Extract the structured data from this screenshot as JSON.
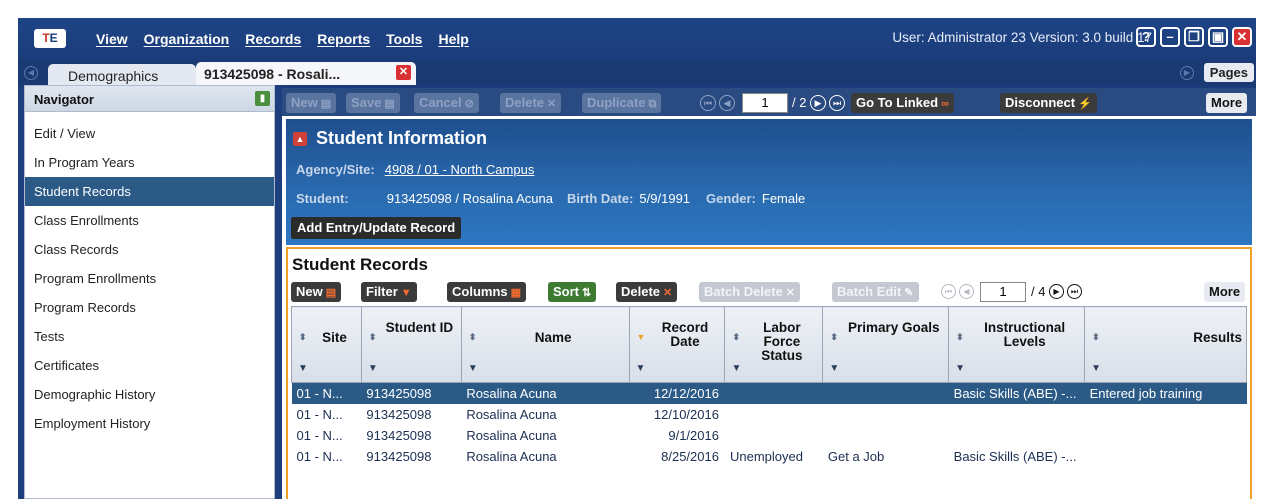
{
  "menubar": {
    "logo": {
      "t": "T",
      "e": "E"
    },
    "items": [
      "View",
      "Organization",
      "Records",
      "Reports",
      "Tools",
      "Help"
    ],
    "user_info": "User: Administrator 23   Version: 3.0 build 17",
    "window_buttons": {
      "help": "?",
      "minimize": "–",
      "restore": "❐",
      "maximize": "▣",
      "close": "✕"
    }
  },
  "tabs": {
    "tab1": "Demographics",
    "tab2": "913425098 - Rosali...",
    "close": "✕",
    "pages": "Pages"
  },
  "navigator": {
    "title": "Navigator",
    "pin_icon": "pin-icon",
    "items": [
      {
        "label": "Edit / View",
        "active": false
      },
      {
        "label": "In Program Years",
        "active": false
      },
      {
        "label": "Student Records",
        "active": true
      },
      {
        "label": "Class Enrollments",
        "active": false
      },
      {
        "label": "Class Records",
        "active": false
      },
      {
        "label": "Program Enrollments",
        "active": false
      },
      {
        "label": "Program Records",
        "active": false
      },
      {
        "label": "Tests",
        "active": false
      },
      {
        "label": "Certificates",
        "active": false
      },
      {
        "label": "Demographic History",
        "active": false
      },
      {
        "label": "Employment History",
        "active": false
      }
    ]
  },
  "toolbar": {
    "new": "New",
    "save": "Save",
    "cancel": "Cancel",
    "delete": "Delete",
    "duplicate": "Duplicate",
    "page": "1",
    "of_total": "/ 2",
    "go_to_linked": "Go To Linked",
    "disconnect": "Disconnect",
    "more": "More"
  },
  "student_info": {
    "title": "Student Information",
    "agency_label": "Agency/Site:",
    "agency_value": "4908 / 01 - North Campus",
    "student_label": "Student:",
    "student_value": "913425098 / Rosalina Acuna",
    "birth_label": "Birth Date:",
    "birth_value": "5/9/1991",
    "gender_label": "Gender:",
    "gender_value": "Female",
    "add_entry": "Add Entry/Update Record"
  },
  "records": {
    "title": "Student Records",
    "toolbar": {
      "new": "New",
      "filter": "Filter",
      "columns": "Columns",
      "sort": "Sort",
      "delete": "Delete",
      "batch_delete": "Batch Delete",
      "batch_edit": "Batch Edit",
      "page": "1",
      "of_total": "/ 4",
      "more": "More"
    },
    "columns": [
      {
        "label": "Site",
        "sort": "both"
      },
      {
        "label": "Student ID",
        "sort": "both"
      },
      {
        "label": "Name",
        "sort": "both"
      },
      {
        "label": "Record Date",
        "sort": "down"
      },
      {
        "label": "Labor Force Status",
        "sort": "both"
      },
      {
        "label": "Primary Goals",
        "sort": "both"
      },
      {
        "label": "Instructional Levels",
        "sort": "both"
      },
      {
        "label": "Results",
        "sort": "both"
      }
    ],
    "rows": [
      {
        "site": "01 - N...",
        "id": "913425098",
        "name": "Rosalina Acuna",
        "date": "12/12/2016",
        "labor": "",
        "goals": "",
        "levels": "Basic Skills (ABE) -...",
        "results": "Entered job training",
        "selected": true
      },
      {
        "site": "01 - N...",
        "id": "913425098",
        "name": "Rosalina Acuna",
        "date": "12/10/2016",
        "labor": "",
        "goals": "",
        "levels": "",
        "results": "",
        "selected": false
      },
      {
        "site": "01 - N...",
        "id": "913425098",
        "name": "Rosalina Acuna",
        "date": "9/1/2016",
        "labor": "",
        "goals": "",
        "levels": "",
        "results": "",
        "selected": false
      },
      {
        "site": "01 - N...",
        "id": "913425098",
        "name": "Rosalina Acuna",
        "date": "8/25/2016",
        "labor": "Unemployed",
        "goals": "Get a Job",
        "levels": "Basic Skills (ABE) -...",
        "results": "",
        "selected": false
      }
    ]
  }
}
